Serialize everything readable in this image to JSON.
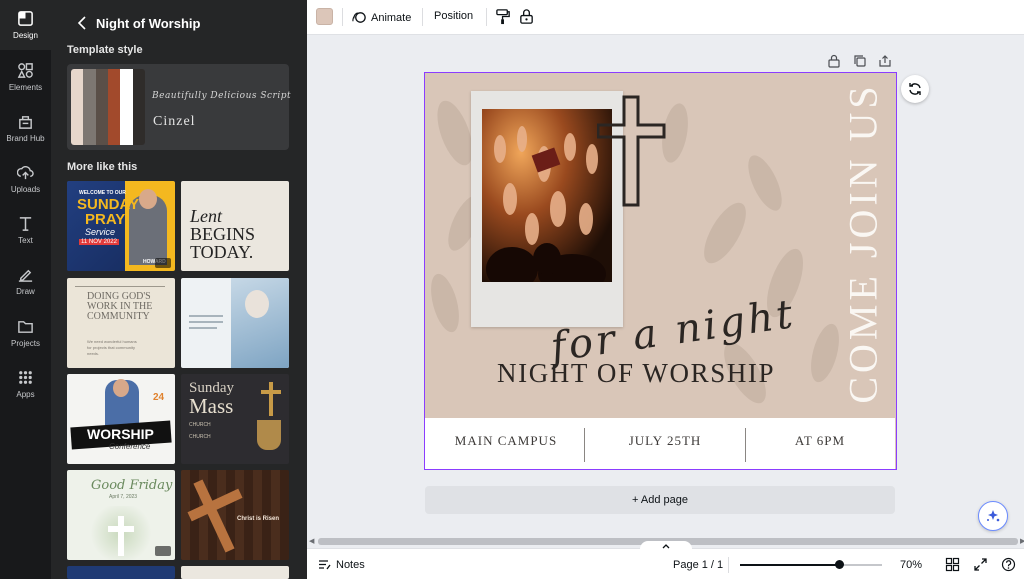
{
  "rail": {
    "items": [
      {
        "label": "Design",
        "icon": "design-icon",
        "active": true
      },
      {
        "label": "Elements",
        "icon": "elements-icon"
      },
      {
        "label": "Brand Hub",
        "icon": "brand-hub-icon"
      },
      {
        "label": "Uploads",
        "icon": "uploads-icon"
      },
      {
        "label": "Text",
        "icon": "text-icon"
      },
      {
        "label": "Draw",
        "icon": "draw-icon"
      },
      {
        "label": "Projects",
        "icon": "projects-icon"
      },
      {
        "label": "Apps",
        "icon": "apps-icon"
      }
    ]
  },
  "panel": {
    "title": "Night of Worship",
    "template_style_label": "Template style",
    "style_card": {
      "swatches": [
        "#e7d7cc",
        "#7d7772",
        "#5a4f48",
        "#a24a2c",
        "#ffffff",
        "#2f2c2a"
      ],
      "font_script": "Beautifully Delicious Script",
      "font_heading": "Cinzel"
    },
    "more_label": "More like this",
    "templates": [
      {
        "texts": [
          "WELCOME TO OUR",
          "SUNDAY",
          "PRAY",
          "Service",
          "11 NOV 2022",
          "HOWARD"
        ]
      },
      {
        "texts": [
          "Lent",
          "BEGINS",
          "TODAY."
        ]
      },
      {
        "texts": [
          "DOING GOD'S",
          "WORK IN THE",
          "COMMUNITY",
          "We need wonderful humans",
          "for projects that community",
          "needs."
        ]
      },
      {
        "texts": []
      },
      {
        "texts": [
          "WORSHIP",
          "Conference",
          "24"
        ]
      },
      {
        "texts": [
          "Sunday",
          "Mass",
          "CHURCH",
          "CHURCH"
        ]
      },
      {
        "texts": [
          "Good Friday",
          "April 7, 2023"
        ]
      },
      {
        "texts": [
          "Christ is Risen"
        ]
      }
    ]
  },
  "toolbar": {
    "color": "#dcc6b9",
    "animate_label": "Animate",
    "position_label": "Position"
  },
  "design": {
    "script_line": "for a night",
    "headline": "NIGHT OF WORSHIP",
    "vertical_text": "COME JOIN US",
    "info": [
      "MAIN CAMPUS",
      "JULY 25TH",
      "AT 6PM"
    ],
    "background": "#d9c6b8",
    "selection_color": "#8b3dff"
  },
  "canvas": {
    "add_page_label": "+ Add page"
  },
  "footer": {
    "notes_label": "Notes",
    "page_label": "Page 1 / 1",
    "zoom_label": "70%",
    "zoom_value": 70
  }
}
